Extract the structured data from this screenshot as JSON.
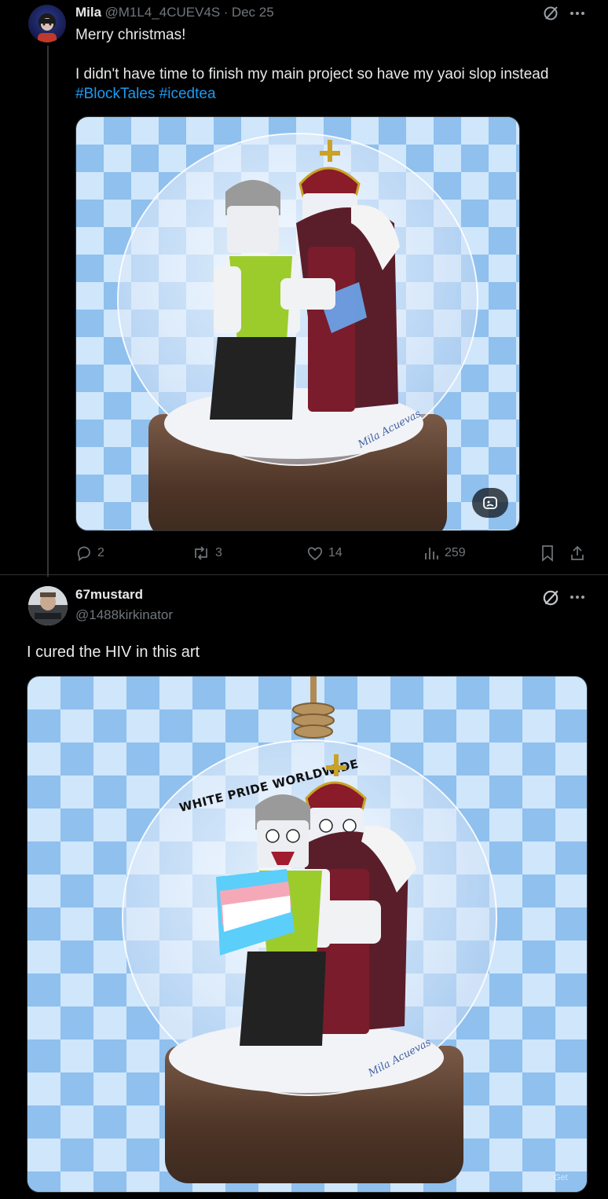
{
  "post1": {
    "author_name": "Mila",
    "author_handle": "@M1L4_4CUEV4S",
    "separator": "·",
    "date": "Dec 25",
    "line1": "Merry christmas!",
    "line2": "I didn't have time to finish my main project so have my yaoi slop instead",
    "hashtag1": "#BlockTales",
    "hashtag2": "#icedtea",
    "signature": "Mila Acuevas",
    "stats": {
      "replies": "2",
      "reposts": "3",
      "likes": "14",
      "views": "259"
    }
  },
  "post2": {
    "author_name": "67mustard",
    "author_handle": "@1488kirkinator",
    "text": "I cured the HIV in this art",
    "banner": "WHITE PRIDE WORLDWIDE",
    "signature": "Mila Acuevas",
    "watermark": "Get"
  },
  "icons": {
    "grok": "grok-slash-icon",
    "more": "more-icon",
    "reply": "reply-icon",
    "repost": "repost-icon",
    "like": "like-icon",
    "views": "views-icon",
    "bookmark": "bookmark-icon",
    "share": "share-icon",
    "media_edit": "media-edit-icon"
  },
  "colors": {
    "background": "#000000",
    "text": "#e7e9ea",
    "muted": "#71767b",
    "link": "#1d9bf0"
  }
}
